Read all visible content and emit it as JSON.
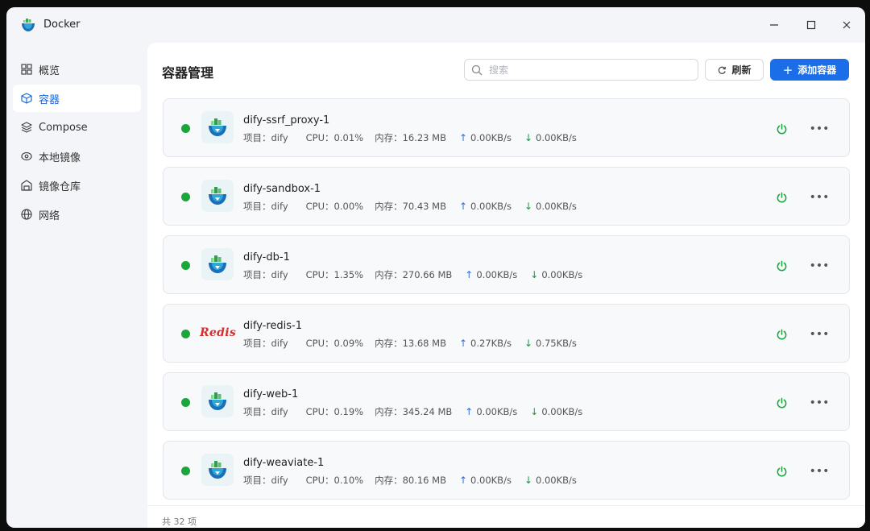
{
  "window": {
    "title": "Docker",
    "controls": {
      "minimize": "—",
      "maximize": "☐",
      "close": "✕"
    }
  },
  "sidebar": {
    "items": [
      {
        "label": "概览",
        "icon": "grid-icon",
        "active": false
      },
      {
        "label": "容器",
        "icon": "cube-icon",
        "active": true
      },
      {
        "label": "Compose",
        "icon": "layers-icon",
        "active": false
      },
      {
        "label": "本地镜像",
        "icon": "disc-icon",
        "active": false
      },
      {
        "label": "镜像仓库",
        "icon": "warehouse-icon",
        "active": false
      },
      {
        "label": "网络",
        "icon": "globe-icon",
        "active": false
      }
    ]
  },
  "header": {
    "title": "容器管理",
    "search": {
      "placeholder": "搜索",
      "value": ""
    },
    "refresh_label": "刷新",
    "add_label": "添加容器",
    "add_icon": "+"
  },
  "containers": [
    {
      "name": "dify-ssrf_proxy-1",
      "icon": "docker-icon",
      "project": "项目：dify",
      "cpu": "CPU：0.01%",
      "memory": "内存：16.23 MB",
      "up": "0.00KB/s",
      "down": "0.00KB/s",
      "status_color": "#1aa63b"
    },
    {
      "name": "dify-sandbox-1",
      "icon": "docker-icon",
      "project": "项目：dify",
      "cpu": "CPU：0.00%",
      "memory": "内存：70.43 MB",
      "up": "0.00KB/s",
      "down": "0.00KB/s",
      "status_color": "#1aa63b"
    },
    {
      "name": "dify-db-1",
      "icon": "docker-icon",
      "project": "项目：dify",
      "cpu": "CPU：1.35%",
      "memory": "内存：270.66 MB",
      "up": "0.00KB/s",
      "down": "0.00KB/s",
      "status_color": "#1aa63b"
    },
    {
      "name": "dify-redis-1",
      "icon": "redis-logo",
      "logo_text": "Redis",
      "project": "项目：dify",
      "cpu": "CPU：0.09%",
      "memory": "内存：13.68 MB",
      "up": "0.27KB/s",
      "down": "0.75KB/s",
      "status_color": "#1aa63b"
    },
    {
      "name": "dify-web-1",
      "icon": "docker-icon",
      "project": "项目：dify",
      "cpu": "CPU：0.19%",
      "memory": "内存：345.24 MB",
      "up": "0.00KB/s",
      "down": "0.00KB/s",
      "status_color": "#1aa63b"
    },
    {
      "name": "dify-weaviate-1",
      "icon": "docker-icon",
      "project": "项目：dify",
      "cpu": "CPU：0.10%",
      "memory": "内存：80.16 MB",
      "up": "0.00KB/s",
      "down": "0.00KB/s",
      "status_color": "#1aa63b"
    }
  ],
  "footer": {
    "total": "共 32 项"
  },
  "colors": {
    "accent": "#1c6ee8",
    "running": "#1aa63b",
    "power": "#1aa63b"
  }
}
